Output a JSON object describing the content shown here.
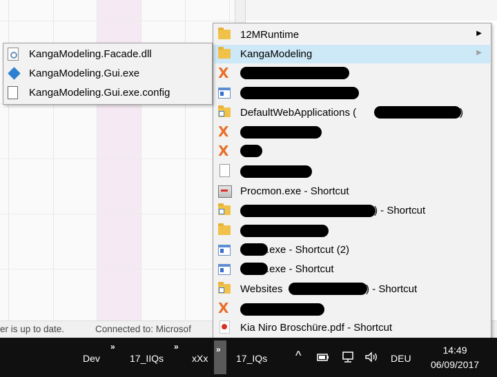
{
  "submenu": {
    "items": [
      {
        "label": "KangaModeling.Facade.dll",
        "icon": "dll-file-icon"
      },
      {
        "label": "KangaModeling.Gui.exe",
        "icon": "app-exe-icon"
      },
      {
        "label": "KangaModeling.Gui.exe.config",
        "icon": "config-file-icon"
      }
    ]
  },
  "menu": {
    "items": [
      {
        "label": "12MRuntime",
        "icon": "folder-icon",
        "has_submenu": true
      },
      {
        "label": "KangaModeling",
        "icon": "folder-icon",
        "has_submenu": true,
        "selected": true
      },
      {
        "label": "",
        "icon": "x-app-icon",
        "redacted": true
      },
      {
        "label": "",
        "icon": "window-app-icon",
        "redacted": true
      },
      {
        "label": "DefaultWebApplications (",
        "suffix": ")",
        "icon": "folder-shortcut-icon",
        "redacted": true
      },
      {
        "label": "",
        "icon": "x-app-icon",
        "redacted": true
      },
      {
        "label": "",
        "icon": "x-app-icon",
        "redacted": true
      },
      {
        "label": "",
        "icon": "document-icon",
        "redacted": true
      },
      {
        "label": "Procmon.exe - Shortcut",
        "icon": "procmon-icon"
      },
      {
        "label": "",
        "suffix": ") - Shortcut",
        "icon": "folder-shortcut-icon",
        "redacted": true
      },
      {
        "label": "",
        "icon": "folder-icon",
        "redacted": true
      },
      {
        "label": "",
        "suffix": ".exe - Shortcut (2)",
        "icon": "window-app-icon",
        "redacted": true
      },
      {
        "label": "",
        "suffix": ".exe - Shortcut",
        "icon": "window-app-icon",
        "redacted": true
      },
      {
        "label": "Websites",
        "suffix": ") - Shortcut",
        "icon": "folder-shortcut-icon",
        "redacted": true
      },
      {
        "label": "",
        "icon": "x-app-icon",
        "redacted": true
      },
      {
        "label": "Kia Niro Broschüre.pdf - Shortcut",
        "icon": "pdf-icon"
      }
    ]
  },
  "statusbar": {
    "left": "er is up to date.",
    "connection": "Connected to: Microsof"
  },
  "taskbar": {
    "toolbars": [
      "Dev",
      "17_IIQs",
      "xXx",
      "17_IQs"
    ],
    "chevron": "»",
    "tray": {
      "up_arrow": "^",
      "language": "DEU",
      "time": "14:49",
      "date": "06/09/2017"
    }
  },
  "colors": {
    "menu_bg": "#f2f2f2",
    "selected_bg": "#cde8f7",
    "taskbar_bg": "#101010",
    "grid_highlight": "#f5e9f3"
  }
}
